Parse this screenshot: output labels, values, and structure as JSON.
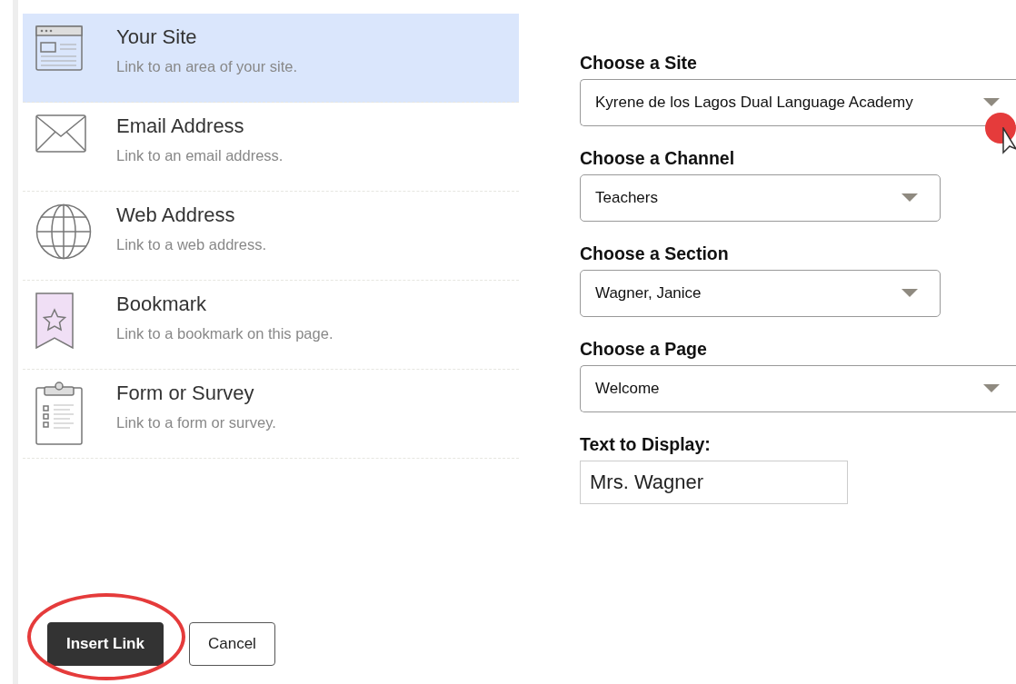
{
  "link_types": [
    {
      "kind": "site",
      "title": "Your Site",
      "description": "Link to an area of your site.",
      "selected": true
    },
    {
      "kind": "email",
      "title": "Email Address",
      "description": "Link to an email address.",
      "selected": false
    },
    {
      "kind": "web",
      "title": "Web Address",
      "description": "Link to a web address.",
      "selected": false
    },
    {
      "kind": "bookmark",
      "title": "Bookmark",
      "description": "Link to a bookmark on this page.",
      "selected": false
    },
    {
      "kind": "form",
      "title": "Form or Survey",
      "description": "Link to a form or survey.",
      "selected": false
    }
  ],
  "fields": [
    {
      "kind": "select",
      "label": "Choose a Site",
      "value": "Kyrene de los Lagos Dual Language Academy"
    },
    {
      "kind": "select",
      "label": "Choose a Channel",
      "value": "Teachers"
    },
    {
      "kind": "select",
      "label": "Choose a Section",
      "value": "Wagner, Janice"
    },
    {
      "kind": "select",
      "label": "Choose a Page",
      "value": "Welcome"
    },
    {
      "kind": "text",
      "label": "Text to Display:",
      "value": "Mrs. Wagner"
    }
  ],
  "buttons": [
    {
      "kind": "primary",
      "label": "Insert Link"
    },
    {
      "kind": "secondary",
      "label": "Cancel"
    }
  ]
}
